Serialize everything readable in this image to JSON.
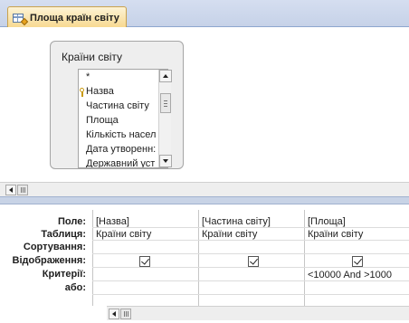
{
  "tab": {
    "icon": "query-design-icon",
    "label": "Площа країн світу"
  },
  "table_box": {
    "title": "Країни світу",
    "fields": [
      {
        "label": "*",
        "primary_key": false
      },
      {
        "label": "Назва",
        "primary_key": true
      },
      {
        "label": "Частина світу",
        "primary_key": false
      },
      {
        "label": "Площа",
        "primary_key": false
      },
      {
        "label": "Кількість насел",
        "primary_key": false
      },
      {
        "label": "Дата утворенн:",
        "primary_key": false
      },
      {
        "label": "Державний уст",
        "primary_key": false
      }
    ]
  },
  "grid": {
    "row_labels": {
      "field": "Поле:",
      "table": "Таблиця:",
      "sort": "Сортування:",
      "show": "Відображення:",
      "criteria": "Критерії:",
      "or": "або:"
    },
    "columns": [
      {
        "field": "[Назва]",
        "table": "Країни світу",
        "sort": "",
        "show": true,
        "criteria": "",
        "or": ""
      },
      {
        "field": "[Частина світу]",
        "table": "Країни світу",
        "sort": "",
        "show": true,
        "criteria": "",
        "or": ""
      },
      {
        "field": "[Площа]",
        "table": "Країни світу",
        "sort": "",
        "show": true,
        "criteria": "<10000 And >1000",
        "or": ""
      }
    ]
  },
  "colors": {
    "tab_active": "#f7d88e",
    "tabstrip": "#c6d2e8",
    "splitter": "#c8d3e6"
  }
}
